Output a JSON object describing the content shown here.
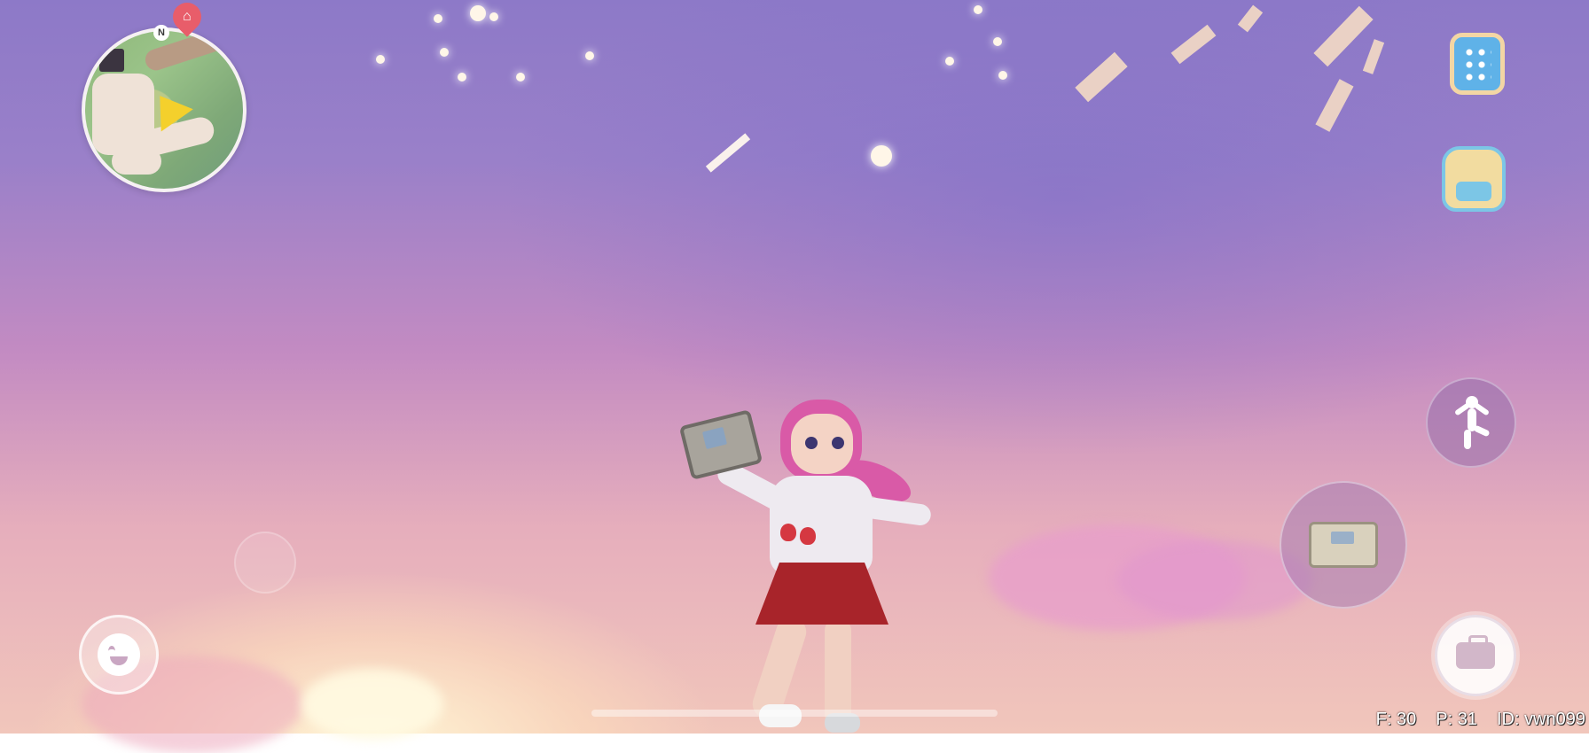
{
  "minimap": {
    "north_label": "N",
    "home_marker": "home-icon",
    "player_marker": "player-arrow-icon"
  },
  "right_menu": {
    "top_icon": "smartwatch-icon",
    "second_icon": "backpack-icon"
  },
  "actions": {
    "dance_icon": "dance-figure-icon",
    "equipped_item_icon": "item-box-icon",
    "toolbox_icon": "toolbox-icon",
    "emote_icon": "smile-face-icon",
    "joystick": "virtual-joystick"
  },
  "debug": {
    "fps": "F: 30",
    "ping": "P: 31",
    "id": "ID: vwn099"
  },
  "colors": {
    "sky_top": "#8d79c8",
    "sky_mid": "#c38bc2",
    "sun_glow": "#fff6d6",
    "hair": "#d95aa7",
    "skirt": "#a8242a"
  }
}
